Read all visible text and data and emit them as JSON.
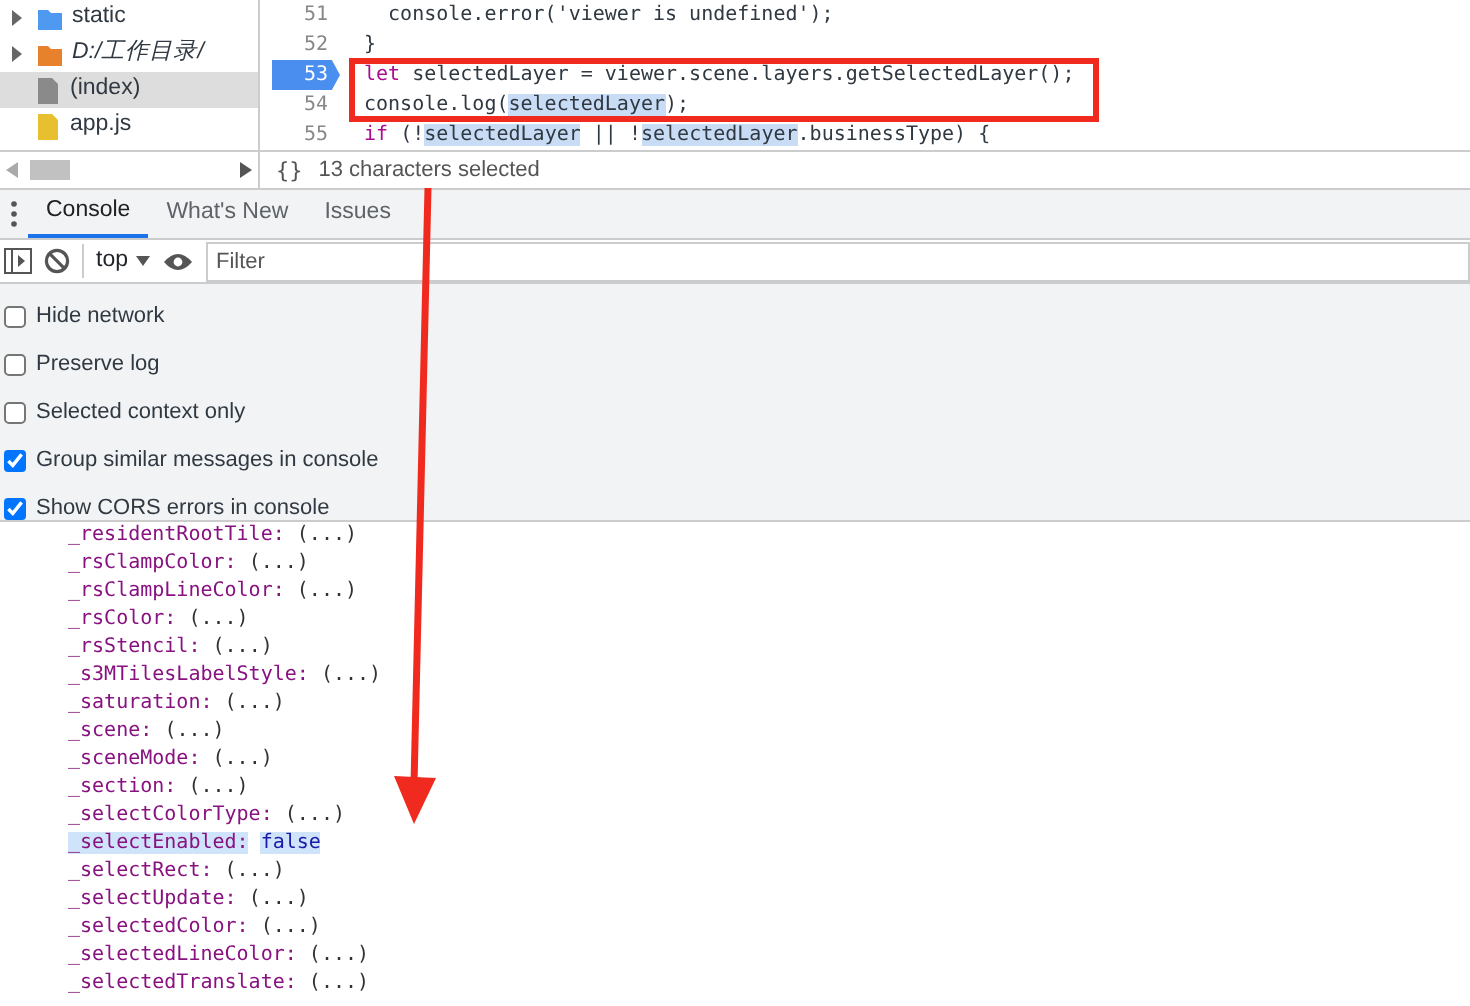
{
  "file_tree": [
    {
      "label": "static",
      "kind": "folder-blue",
      "selected": false,
      "italic": false
    },
    {
      "label": "D:/工作目录/",
      "kind": "folder-orange",
      "selected": false,
      "italic": true
    },
    {
      "label": "(index)",
      "kind": "file-gray",
      "selected": true,
      "italic": false
    },
    {
      "label": "app.js",
      "kind": "file-yellow",
      "selected": false,
      "italic": false
    }
  ],
  "editor": {
    "lines": [
      {
        "number": "51",
        "current": false,
        "segments": [
          {
            "text": "  console.error('viewer is undefined');",
            "kind": "plain"
          }
        ]
      },
      {
        "number": "52",
        "current": false,
        "segments": [
          {
            "text": "}",
            "kind": "plain"
          }
        ]
      },
      {
        "number": "53",
        "current": true,
        "segments": [
          {
            "text": "let",
            "kind": "keyword"
          },
          {
            "text": " selectedLayer = viewer.scene.layers.getSelectedLayer();",
            "kind": "plain"
          }
        ]
      },
      {
        "number": "54",
        "current": false,
        "segments": [
          {
            "text": "console.log(",
            "kind": "plain"
          },
          {
            "text": "selectedLayer",
            "kind": "match"
          },
          {
            "text": ");",
            "kind": "plain"
          }
        ]
      },
      {
        "number": "55",
        "current": false,
        "segments": [
          {
            "text": "if",
            "kind": "keyword"
          },
          {
            "text": " (!",
            "kind": "plain"
          },
          {
            "text": "selectedLayer",
            "kind": "match"
          },
          {
            "text": " || !",
            "kind": "plain"
          },
          {
            "text": "selectedLayer",
            "kind": "match"
          },
          {
            "text": ".businessType) {",
            "kind": "plain"
          }
        ]
      }
    ],
    "format_button": "{}",
    "status": "13 characters selected"
  },
  "drawer_tabs": [
    {
      "label": "Console",
      "selected": true
    },
    {
      "label": "What's New",
      "selected": false
    },
    {
      "label": "Issues",
      "selected": false
    }
  ],
  "toolbar": {
    "context": "top",
    "filter": {
      "placeholder": "Filter"
    }
  },
  "settings": [
    {
      "label": "Hide network",
      "checked": false
    },
    {
      "label": "Preserve log",
      "checked": false
    },
    {
      "label": "Selected context only",
      "checked": false
    },
    {
      "label": "Group similar messages in console",
      "checked": true
    },
    {
      "label": "Show CORS errors in console",
      "checked": true
    }
  ],
  "console_rows": [
    {
      "key": "_residentRootTile:",
      "value": "(...)",
      "kind": "getter",
      "selected": false
    },
    {
      "key": "_rsClampColor:",
      "value": "(...)",
      "kind": "getter",
      "selected": false
    },
    {
      "key": "_rsClampLineColor:",
      "value": "(...)",
      "kind": "getter",
      "selected": false
    },
    {
      "key": "_rsColor:",
      "value": "(...)",
      "kind": "getter",
      "selected": false
    },
    {
      "key": "_rsStencil:",
      "value": "(...)",
      "kind": "getter",
      "selected": false
    },
    {
      "key": "_s3MTilesLabelStyle:",
      "value": "(...)",
      "kind": "getter",
      "selected": false
    },
    {
      "key": "_saturation:",
      "value": "(...)",
      "kind": "getter",
      "selected": false
    },
    {
      "key": "_scene:",
      "value": "(...)",
      "kind": "getter",
      "selected": false
    },
    {
      "key": "_sceneMode:",
      "value": "(...)",
      "kind": "getter",
      "selected": false
    },
    {
      "key": "_section:",
      "value": "(...)",
      "kind": "getter",
      "selected": false
    },
    {
      "key": "_selectColorType:",
      "value": "(...)",
      "kind": "getter",
      "selected": false
    },
    {
      "key": "_selectEnabled:",
      "value": "false",
      "kind": "boolean",
      "selected": true
    },
    {
      "key": "_selectRect:",
      "value": "(...)",
      "kind": "getter",
      "selected": false
    },
    {
      "key": "_selectUpdate:",
      "value": "(...)",
      "kind": "getter",
      "selected": false
    },
    {
      "key": "_selectedColor:",
      "value": "(...)",
      "kind": "getter",
      "selected": false
    },
    {
      "key": "_selectedLineColor:",
      "value": "(...)",
      "kind": "getter",
      "selected": false
    },
    {
      "key": "_selectedTranslate:",
      "value": "(...)",
      "kind": "getter",
      "selected": false
    }
  ]
}
